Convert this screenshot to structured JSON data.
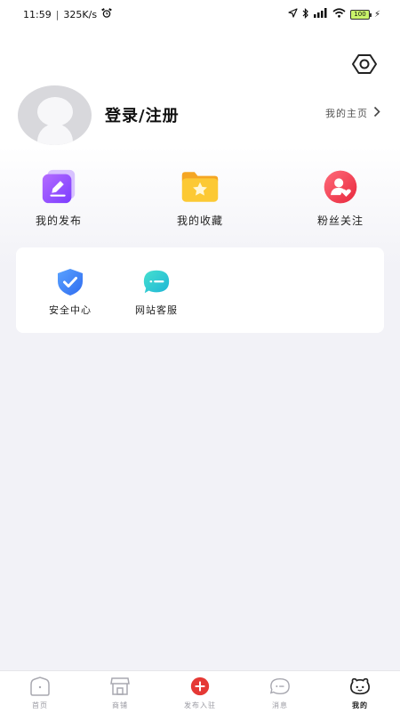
{
  "status_bar": {
    "time": "11:59",
    "speed": "325K/s",
    "battery": "100"
  },
  "profile": {
    "login_label": "登录/注册",
    "homepage_label": "我的主页"
  },
  "quick_actions": [
    {
      "label": "我的发布",
      "icon": "edit-icon",
      "color": "#8c4dff"
    },
    {
      "label": "我的收藏",
      "icon": "star-folder-icon",
      "color": "#fbbf24"
    },
    {
      "label": "粉丝关注",
      "icon": "fans-heart-icon",
      "color": "#ef4452"
    }
  ],
  "services": [
    {
      "label": "安全中心",
      "icon": "shield-check-icon",
      "color": "#3b82f6"
    },
    {
      "label": "网站客服",
      "icon": "chat-bubble-icon",
      "color": "#2dd4bf"
    }
  ],
  "bottom_nav": [
    {
      "label": "首页",
      "icon": "home-icon"
    },
    {
      "label": "商铺",
      "icon": "shop-icon"
    },
    {
      "label": "发布入驻",
      "icon": "plus-circle-icon",
      "color": "#e53935"
    },
    {
      "label": "消息",
      "icon": "message-icon"
    },
    {
      "label": "我的",
      "icon": "face-icon",
      "active": true
    }
  ]
}
